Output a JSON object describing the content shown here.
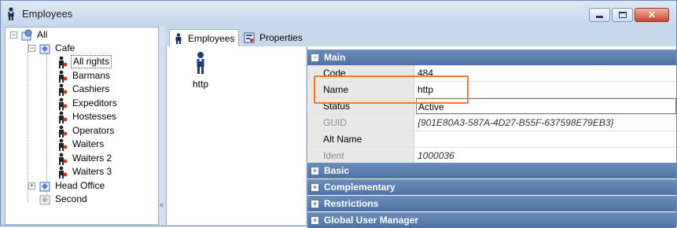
{
  "window": {
    "title": "Employees",
    "icon": "person-icon",
    "controls": [
      "minimize",
      "maximize",
      "close"
    ]
  },
  "tree": {
    "root": {
      "label": "All",
      "expander": "−"
    },
    "cafe": {
      "label": "Cafe",
      "expander": "−"
    },
    "cafe_children": [
      {
        "label": "All rights",
        "selected": true
      },
      {
        "label": "Barmans"
      },
      {
        "label": "Cashiers"
      },
      {
        "label": "Expeditors"
      },
      {
        "label": "Hostesses"
      },
      {
        "label": "Operators"
      },
      {
        "label": "Waiters"
      },
      {
        "label": "Waiters 2"
      },
      {
        "label": "Waiters 3"
      }
    ],
    "head_office": {
      "label": "Head Office",
      "expander": "+"
    },
    "second": {
      "label": "Second"
    }
  },
  "splitter": {
    "arrow": "<"
  },
  "tabs": [
    {
      "label": "Employees",
      "icon": "person-icon",
      "active": true
    },
    {
      "label": "Properties",
      "icon": "properties-icon",
      "active": false
    }
  ],
  "employee_list": [
    {
      "label": "http",
      "icon": "person-icon"
    }
  ],
  "properties": {
    "main": {
      "label": "Main",
      "toggle": "−"
    },
    "rows": [
      {
        "name": "Code",
        "value": "484"
      },
      {
        "name": "Name",
        "value": "http"
      },
      {
        "name": "Status",
        "value": "Active"
      },
      {
        "name": "GUID",
        "value": "{901E80A3-587A-4D27-B55F-637598E79EB3}"
      },
      {
        "name": "Alt Name",
        "value": ""
      },
      {
        "name": "Ident",
        "value": "1000036"
      }
    ],
    "categories": [
      {
        "label": "Basic",
        "toggle": "+"
      },
      {
        "label": "Complementary",
        "toggle": "+"
      },
      {
        "label": "Restrictions",
        "toggle": "+"
      },
      {
        "label": "Global User Manager",
        "toggle": "+"
      }
    ]
  },
  "colors": {
    "category_header": "#4f72a4",
    "highlight_box": "#ef7a2a",
    "window_frame": "#c9d8ea"
  }
}
